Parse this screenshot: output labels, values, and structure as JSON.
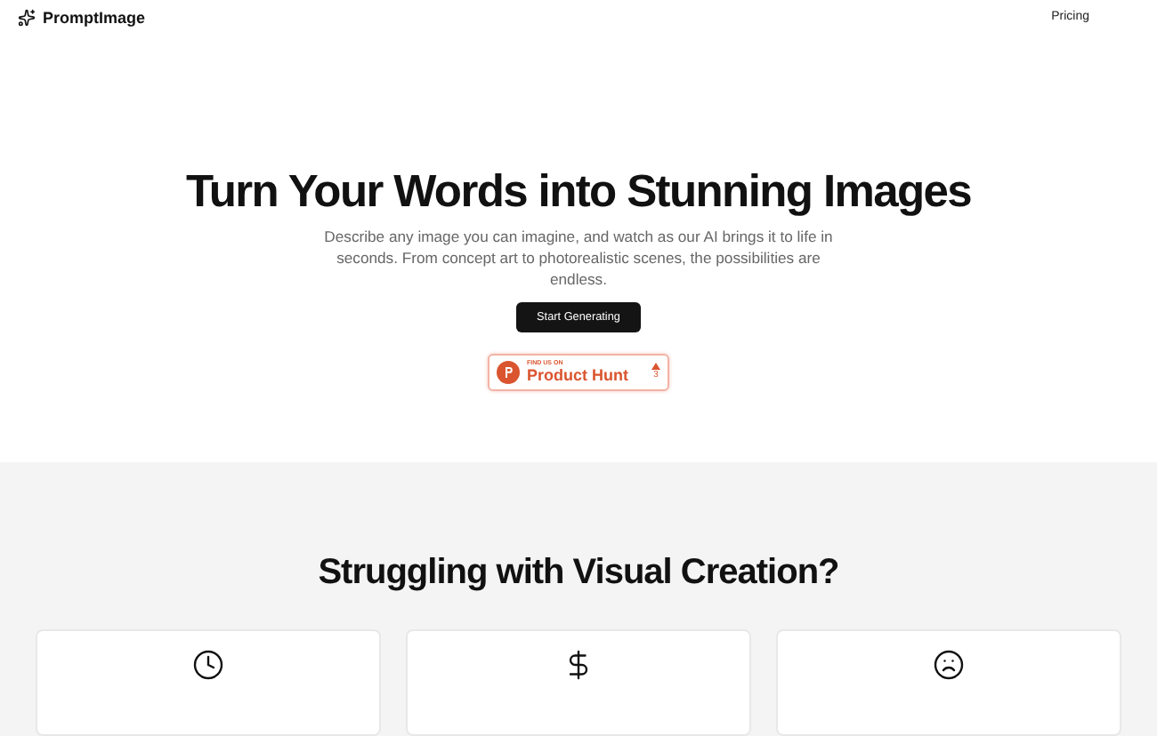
{
  "header": {
    "brand": "PromptImage",
    "nav": [
      "Pricing"
    ]
  },
  "hero": {
    "title": "Turn Your Words into Stunning Images",
    "subtitle": "Describe any image you can imagine, and watch as our AI brings it to life in seconds. From concept art to photorealistic scenes, the possibilities are endless.",
    "cta": "Start Generating",
    "badge": {
      "kicker": "FIND US ON",
      "name": "Product Hunt",
      "votes": "3"
    }
  },
  "problems": {
    "title": "Struggling with Visual Creation?",
    "cards": [
      {
        "kind": "clock"
      },
      {
        "kind": "dollar"
      },
      {
        "kind": "frown"
      }
    ]
  }
}
